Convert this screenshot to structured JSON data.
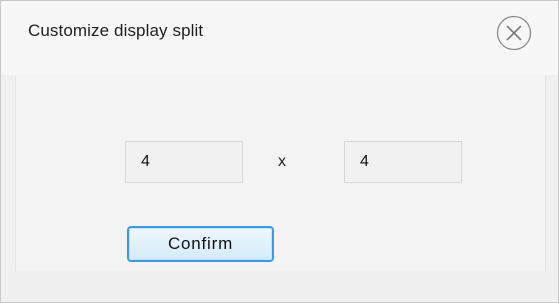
{
  "dialog": {
    "title": "Customize display split",
    "close_icon": "close-circle-icon"
  },
  "split": {
    "rows": "4",
    "separator": "x",
    "columns": "4"
  },
  "actions": {
    "confirm_label": "Confirm"
  },
  "colors": {
    "button_border": "#3c9be0",
    "button_fill": "#d4ebf9",
    "background": "#f0f0f0"
  }
}
